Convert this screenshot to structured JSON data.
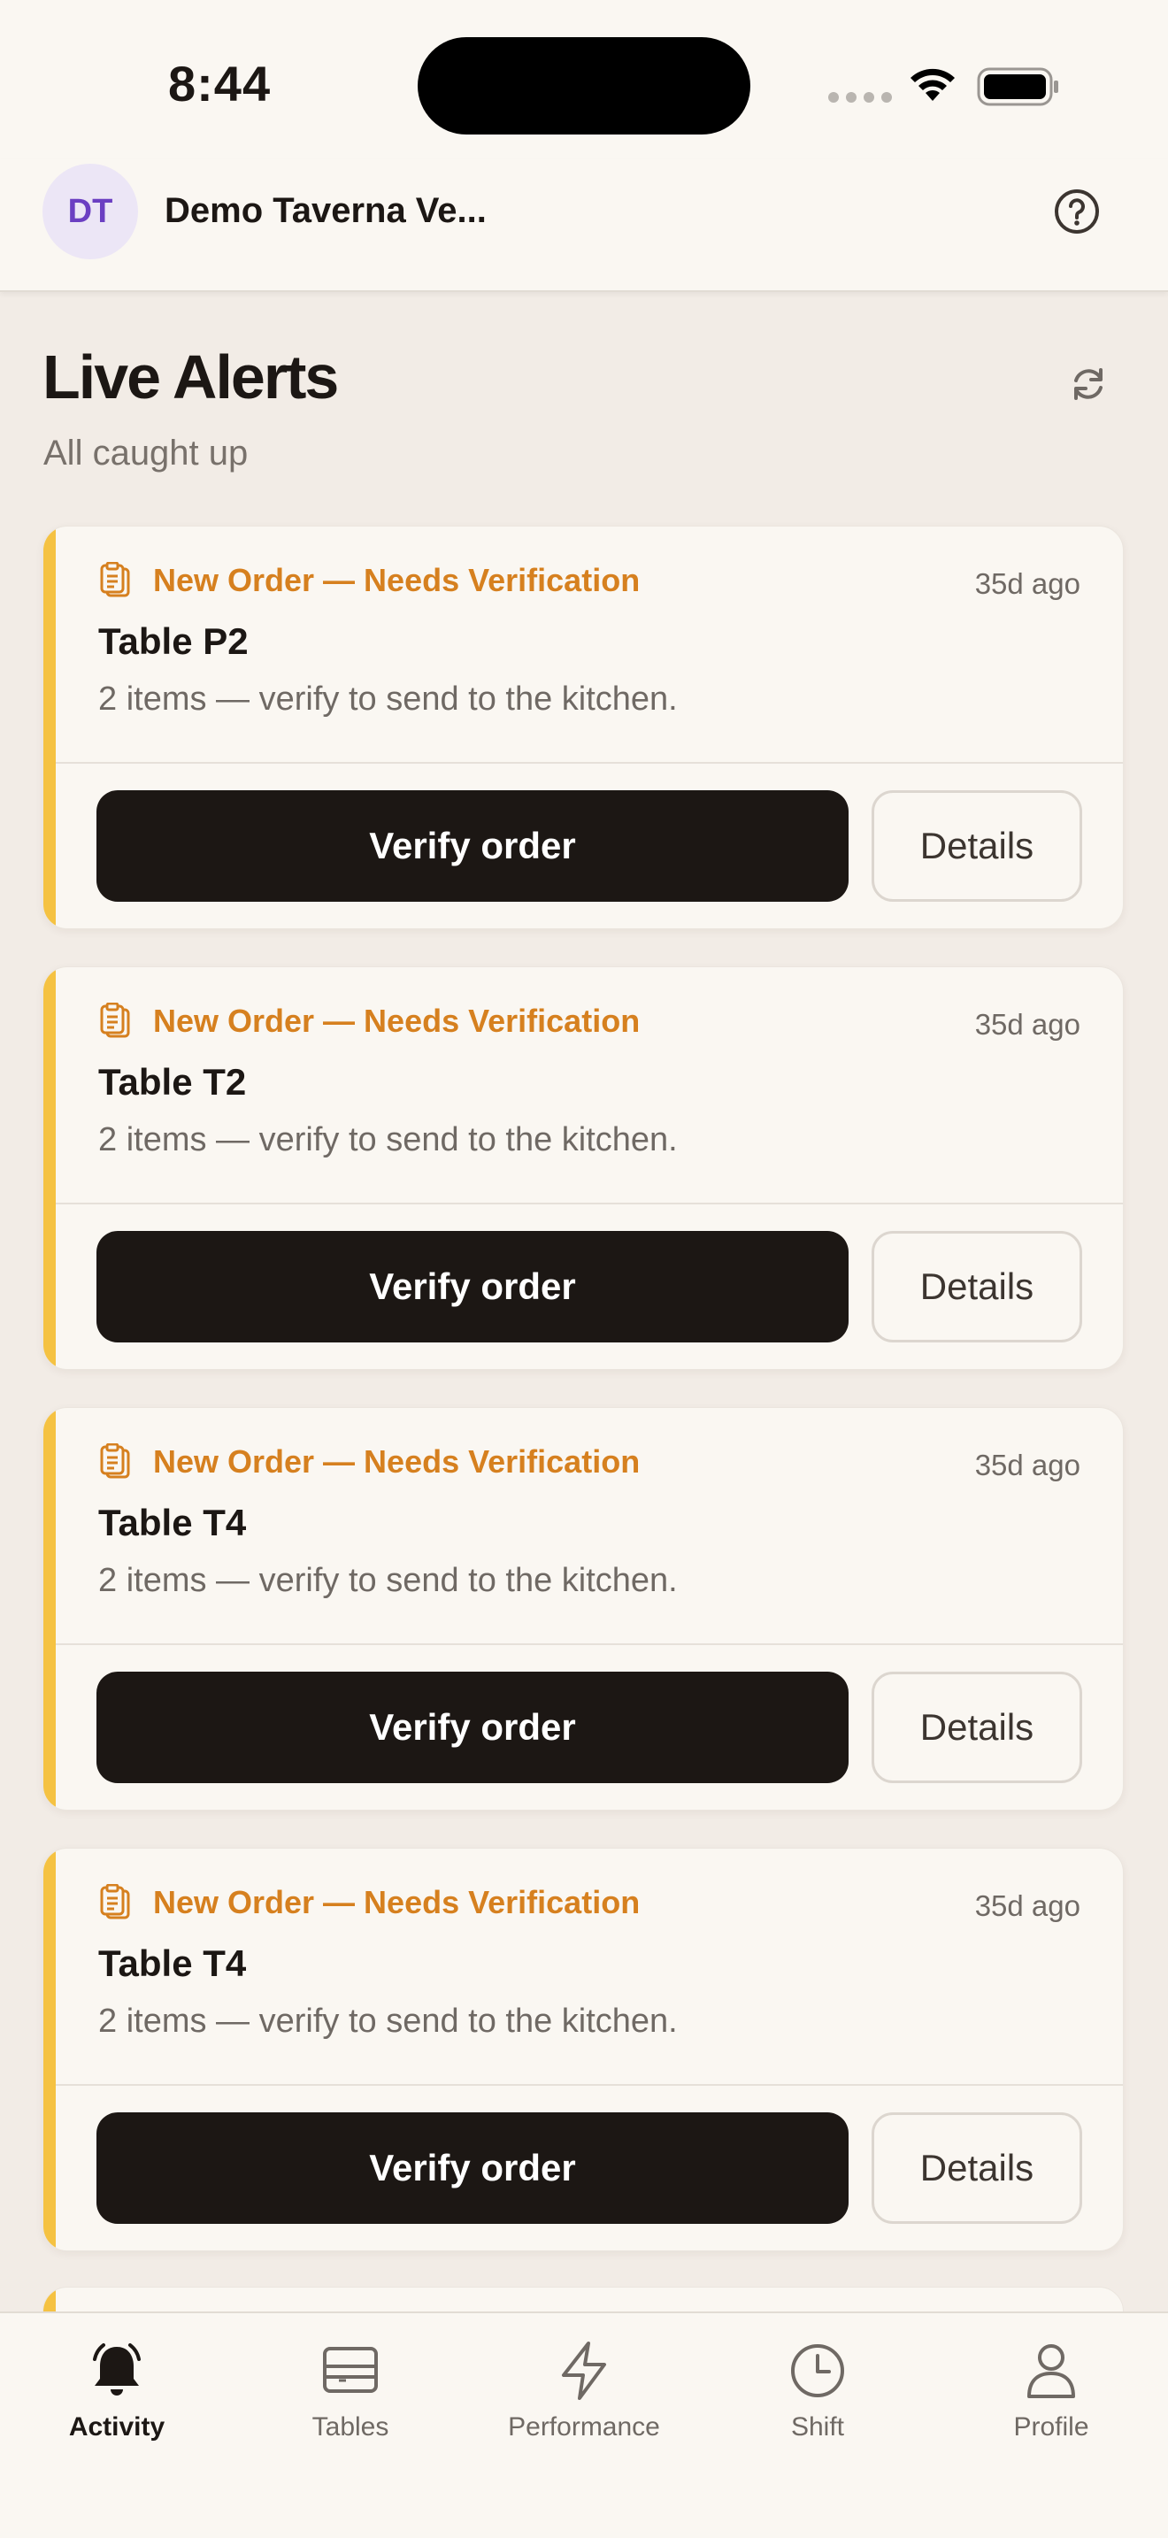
{
  "status_bar": {
    "time": "8:44"
  },
  "header": {
    "avatar_initials": "DT",
    "venue_name": "Demo Taverna Ve..."
  },
  "page": {
    "title": "Live Alerts",
    "subtitle": "All caught up"
  },
  "alerts": [
    {
      "type": "New Order — Needs Verification",
      "time": "35d ago",
      "table": "Table P2",
      "description": "2 items — verify to send to the kitchen.",
      "primary_action": "Verify order",
      "secondary_action": "Details"
    },
    {
      "type": "New Order — Needs Verification",
      "time": "35d ago",
      "table": "Table T2",
      "description": "2 items — verify to send to the kitchen.",
      "primary_action": "Verify order",
      "secondary_action": "Details"
    },
    {
      "type": "New Order — Needs Verification",
      "time": "35d ago",
      "table": "Table T4",
      "description": "2 items — verify to send to the kitchen.",
      "primary_action": "Verify order",
      "secondary_action": "Details"
    },
    {
      "type": "New Order — Needs Verification",
      "time": "35d ago",
      "table": "Table T4",
      "description": "2 items — verify to send to the kitchen.",
      "primary_action": "Verify order",
      "secondary_action": "Details"
    }
  ],
  "nav": {
    "items": [
      {
        "label": "Activity",
        "icon": "bell-icon",
        "active": true
      },
      {
        "label": "Tables",
        "icon": "tables-icon",
        "active": false
      },
      {
        "label": "Performance",
        "icon": "lightning-icon",
        "active": false
      },
      {
        "label": "Shift",
        "icon": "clock-icon",
        "active": false
      },
      {
        "label": "Profile",
        "icon": "person-icon",
        "active": false
      }
    ]
  },
  "colors": {
    "accent_stripe": "#f5c242",
    "alert_type": "#d6801f",
    "primary_button": "#1c1714",
    "avatar_text": "#6b3fc2"
  }
}
